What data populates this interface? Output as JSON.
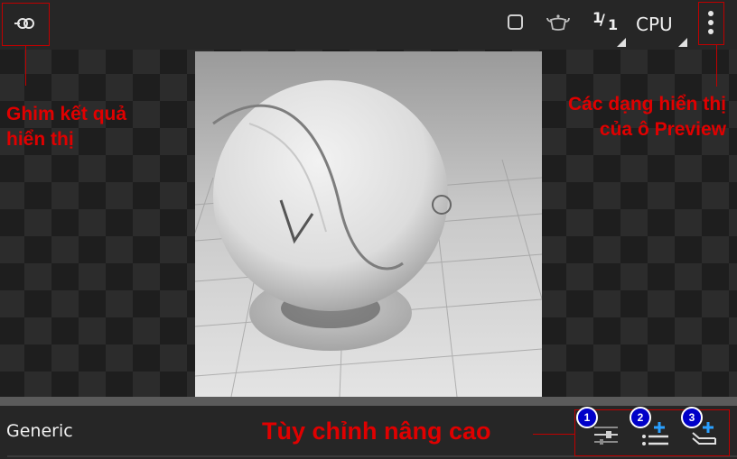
{
  "toolbar": {
    "pin_icon": "pin-result-icon",
    "render_region_icon": "square-icon",
    "scene_icon": "teapot-icon",
    "resolution_label": "1/1",
    "resolution_num": "1",
    "resolution_den": "1",
    "engine_label": "CPU",
    "more_icon": "vertical-ellipsis-icon"
  },
  "preview": {
    "description": "Material preview sphere on tiled floor"
  },
  "footer": {
    "material_type": "Generic",
    "buttons": [
      {
        "icon": "sliders-icon",
        "badge": "1"
      },
      {
        "icon": "add-list-icon",
        "badge": "2"
      },
      {
        "icon": "add-layer-icon",
        "badge": "3"
      }
    ]
  },
  "annotations": {
    "pin_line1": "Ghim kết quả",
    "pin_line2": "hiển thị",
    "views_line1": "Các dạng hiển thị",
    "views_line2": "của ô Preview",
    "advanced": "Tùy chỉnh nâng cao"
  },
  "colors": {
    "annotation_red": "#e00000",
    "badge_blue": "#0000c8"
  }
}
